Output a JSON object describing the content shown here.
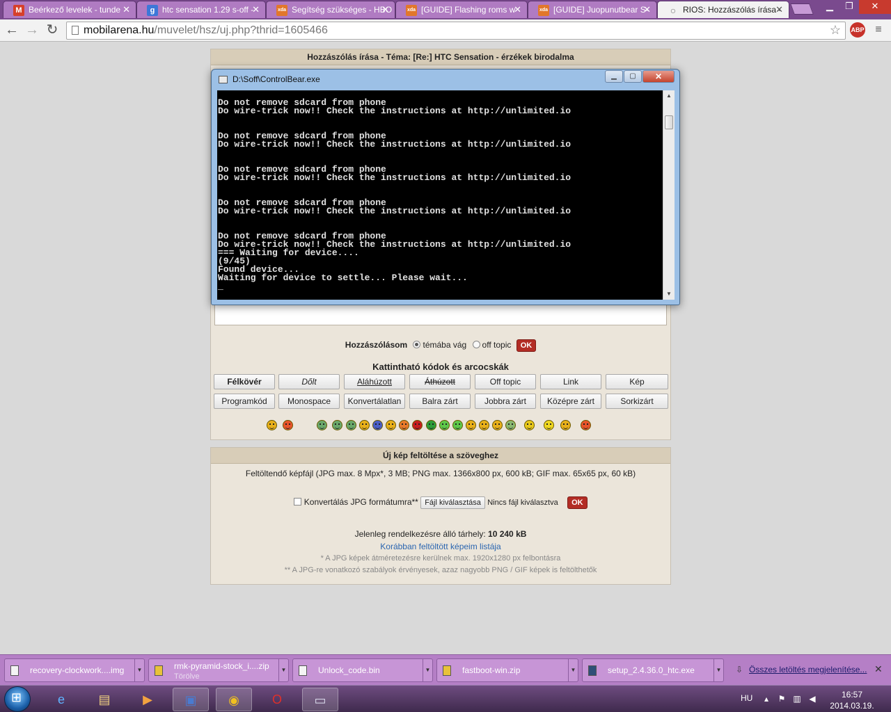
{
  "browser": {
    "tabs": [
      {
        "label": "Beérkező levelek - tunde",
        "icon": "gmail-icon",
        "glyph": "M",
        "color": "#d6402b"
      },
      {
        "label": "htc sensation 1.29 s-off -",
        "icon": "google-icon",
        "glyph": "g",
        "color": "#3d77d8"
      },
      {
        "label": "Segítség szükséges - HBO",
        "icon": "xda-icon",
        "glyph": "xda",
        "color": "#e2772b"
      },
      {
        "label": "[GUIDE] Flashing roms w",
        "icon": "xda-icon",
        "glyph": "xda",
        "color": "#e2772b"
      },
      {
        "label": "[GUIDE] Juopunutbear S-",
        "icon": "xda-icon",
        "glyph": "xda",
        "color": "#e2772b"
      },
      {
        "label": "RIOS: Hozzászólás írása -",
        "icon": "loading-icon",
        "glyph": "○",
        "color": "#777777"
      }
    ],
    "url_host": "mobilarena.hu",
    "url_path": "/muvelet/hsz/uj.php?thrid=1605466",
    "abp_label": "ABP"
  },
  "forum": {
    "header": "Hozzászólás írása - Téma: [Re:] HTC Sensation - érzékek birodalma",
    "post_label": "Hozzászólásom",
    "radio_topic": "témába vág",
    "radio_offtopic": "off topic",
    "ok_label": "OK",
    "codes_title": "Kattintható kódok és arcocskák",
    "code_buttons_row1": [
      "Félkövér",
      "Dőlt",
      "Aláhúzott",
      "Áthúzott",
      "Off topic",
      "Link",
      "Kép"
    ],
    "code_buttons_row2": [
      "Programkód",
      "Monospace",
      "Konvertálatlan",
      "Balra zárt",
      "Jobbra zárt",
      "Középre zárt",
      "Sorkizárt"
    ],
    "smiley_colors": [
      "#e8b01a",
      "#e8542b",
      "#6aa86a",
      "#6aa86a",
      "#6aa86a",
      "#e8b01a",
      "#4a5ec8",
      "#e8b01a",
      "#e87a2b",
      "#c81e1e",
      "#2e9e3a",
      "#5ec84a",
      "#5ec84a",
      "#e8b01a",
      "#e8b01a",
      "#e8b01a",
      "#8ab870",
      "#e8c81a",
      "#f0d820",
      "#e8b01a",
      "#e8542b"
    ]
  },
  "upload": {
    "header": "Új kép feltöltése a szöveghez",
    "file_label": "Feltöltendő képfájl (JPG max. 8 Mpx*, 3 MB; PNG max. 1366x800 px, 600 kB; GIF max. 65x65 px, 60 kB)",
    "convert_label": "Konvertálás JPG formátumra**",
    "choose_file": "Fájl kiválasztása",
    "no_file": "Nincs fájl kiválasztva",
    "ok_label": "OK",
    "storage_label": "Jelenleg rendelkezésre álló tárhely:",
    "storage_value": "10 240 kB",
    "previous_link": "Korábban feltöltött képeim listája",
    "note1": "* A JPG képek átméretezésre kerülnek max. 1920x1280 px felbontásra",
    "note2": "** A JPG-re vonatkozó szabályok érvényesek, azaz nagyobb PNG / GIF képek is feltölthetők"
  },
  "console": {
    "title": "D:\\Soff\\ControlBear.exe",
    "minimize": "▁",
    "maximize": "▢",
    "close": "✕",
    "text": "\nDo not remove sdcard from phone\nDo wire-trick now!! Check the instructions at http://unlimited.io\n\n\nDo not remove sdcard from phone\nDo wire-trick now!! Check the instructions at http://unlimited.io\n\n\nDo not remove sdcard from phone\nDo wire-trick now!! Check the instructions at http://unlimited.io\n\n\nDo not remove sdcard from phone\nDo wire-trick now!! Check the instructions at http://unlimited.io\n\n\nDo not remove sdcard from phone\nDo wire-trick now!! Check the instructions at http://unlimited.io\n=== Waiting for device....\n(9/45)\nFound device...\nWaiting for device to settle... Please wait...\n_"
  },
  "downloads": {
    "items": [
      {
        "name": "recovery-clockwork....img",
        "sub": "",
        "icon": "file-icon"
      },
      {
        "name": "rmk-pyramid-stock_i....zip",
        "sub": "Törölve",
        "icon": "zip-icon"
      },
      {
        "name": "Unlock_code.bin",
        "sub": "",
        "icon": "file-icon"
      },
      {
        "name": "fastboot-win.zip",
        "sub": "",
        "icon": "zip-icon"
      },
      {
        "name": "setup_2.4.36.0_htc.exe",
        "sub": "",
        "icon": "exe-icon"
      }
    ],
    "show_all": "Összes letöltés megjelenítése..."
  },
  "taskbar": {
    "language": "HU",
    "time": "16:57",
    "date": "2014.03.19.",
    "apps": [
      "ie-icon",
      "explorer-icon",
      "media-player-icon",
      "save-icon",
      "chrome-icon",
      "opera-icon",
      "console-icon"
    ]
  }
}
